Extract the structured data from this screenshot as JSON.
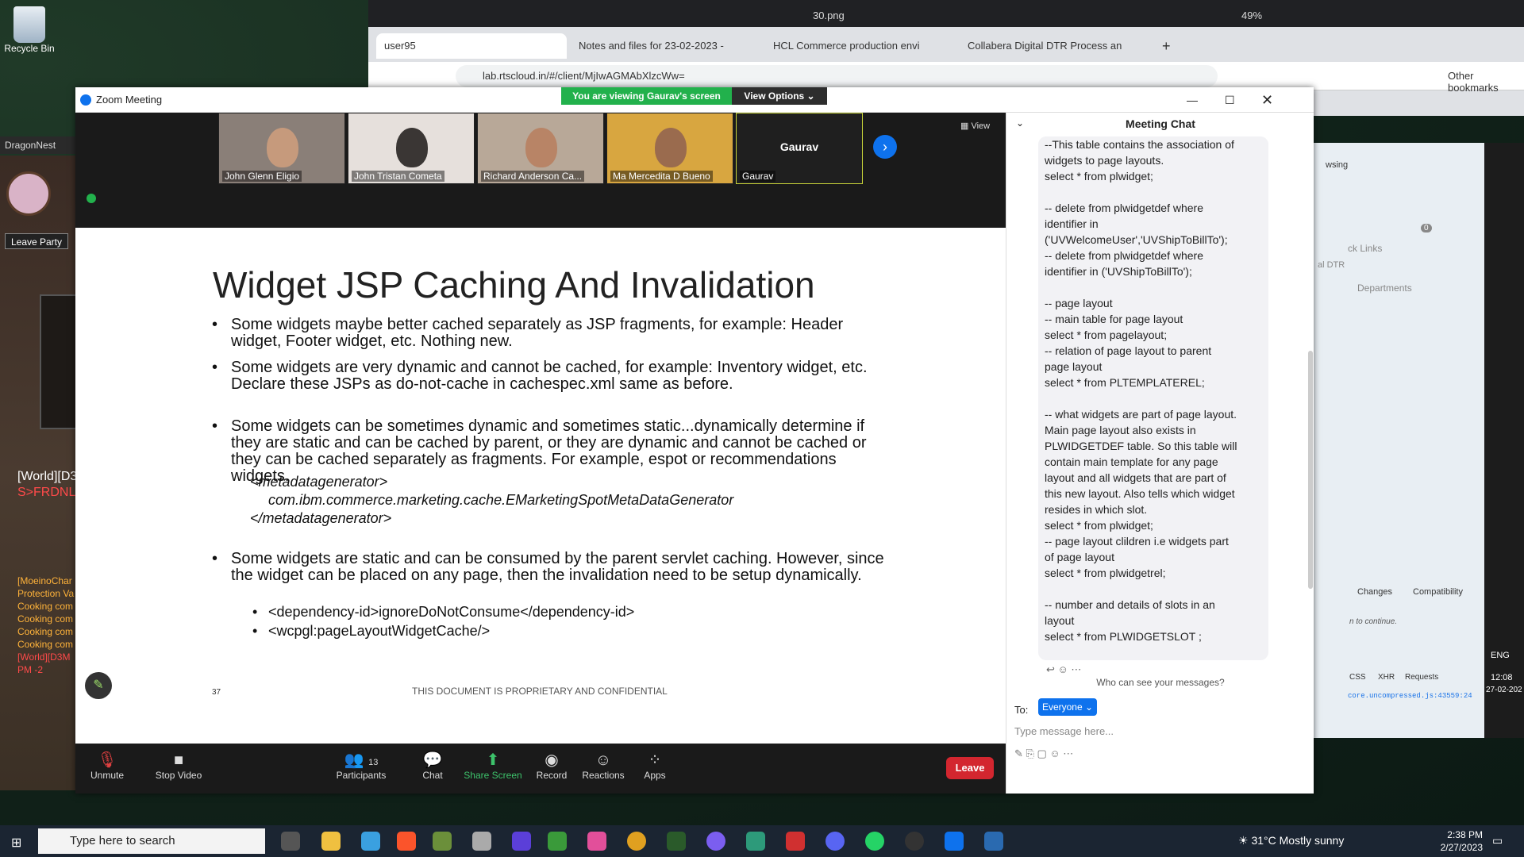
{
  "desktop": {
    "recycle_bin": "Recycle Bin",
    "dragonnest": "DragonNest"
  },
  "game": {
    "leave_party": "Leave Party",
    "world_line1": "[World][D3",
    "world_line2": "S>FRDNL",
    "chat_lines": [
      "[MoeinoChar",
      "Protection Va",
      "Cooking com",
      "Cooking com",
      "Cooking com",
      "Cooking com",
      "[World][D3M",
      "PM -2"
    ]
  },
  "browser": {
    "tabs": [
      {
        "label": "user95"
      },
      {
        "label": "Notes and files for 23-02-2023 -"
      },
      {
        "label": "HCL Commerce production envi"
      },
      {
        "label": "Collabera Digital DTR Process an"
      }
    ],
    "url": "lab.rtscloud.in/#/client/MjIwAGMAbXlzcWw=",
    "other_bookmarks": "Other bookmarks",
    "top_file": "30.png",
    "zoom_pct": "49%"
  },
  "zoom": {
    "title": "Zoom Meeting",
    "viewing_banner": "You are viewing Gaurav's screen",
    "view_options": "View Options",
    "view_label": "View",
    "participants": [
      {
        "name": "John Glenn Eligio"
      },
      {
        "name": "John Tristan Cometa"
      },
      {
        "name": "Richard Anderson Ca..."
      },
      {
        "name": "Ma Mercedita D Bueno"
      },
      {
        "name": "Gaurav",
        "display": "Gaurav"
      }
    ],
    "toolbar": {
      "unmute": "Unmute",
      "stop_video": "Stop Video",
      "participants": "Participants",
      "participants_count": "13",
      "chat": "Chat",
      "share_screen": "Share Screen",
      "record": "Record",
      "reactions": "Reactions",
      "apps": "Apps",
      "leave": "Leave"
    }
  },
  "slide": {
    "title": "Widget JSP Caching And Invalidation",
    "bullets": [
      "Some widgets maybe better cached separately as JSP fragments, for example: Header widget, Footer widget, etc. Nothing new.",
      "Some widgets are very dynamic and cannot be cached, for example: Inventory widget, etc. Declare these JSPs as do-not-cache in cachespec.xml same as before.",
      "Some widgets can be sometimes dynamic and sometimes static...dynamically determine if they are static and can be cached by parent, or they are dynamic and cannot be cached or they can be cached separately as fragments. For example, espot or recommendations widgets.",
      "Some widgets are static and can be consumed by the parent servlet caching. However, since the widget can be placed on any page, then the invalidation need to be setup dynamically."
    ],
    "code1": "<metadatagenerator>",
    "code2": "com.ibm.commerce.marketing.cache.EMarketingSpotMetaDataGenerator",
    "code3": "</metadatagenerator>",
    "sub1": "<dependency-id>ignoreDoNotConsume</dependency-id>",
    "sub2": "<wcpgl:pageLayoutWidgetCache/>",
    "footer": "THIS DOCUMENT IS PROPRIETARY AND CONFIDENTIAL",
    "page_number": "37"
  },
  "chat": {
    "header": "Meeting Chat",
    "message": "--This table contains the association of\nwidgets to page layouts.\nselect * from plwidget;\n\n-- delete from plwidgetdef where\nidentifier in\n('UVWelcomeUser','UVShipToBillTo');\n-- delete from plwidgetdef where\nidentifier in ('UVShipToBillTo');\n\n-- page layout\n-- main table for page layout\nselect * from pagelayout;\n-- relation of page layout to parent\npage layout\nselect * from PLTEMPLATEREL;\n\n-- what widgets are part of page layout.\nMain page layout also exists in\nPLWIDGETDEF table. So this table will\ncontain main template for any page\nlayout and all widgets that are part of\nthis new layout. Also tells which widget\nresides in which slot.\nselect * from plwidget;\n-- page layout clildren i.e widgets part\nof page layout\nselect * from plwidgetrel;\n\n-- number and details of slots in an\nlayout\nselect * from PLWIDGETSLOT ;",
    "who_can_see": "Who can see your messages?",
    "to_label": "To:",
    "everyone": "Everyone",
    "placeholder": "Type message here..."
  },
  "bg_right": {
    "links": "ck Links",
    "departments": "Departments",
    "dtr": "al DTR",
    "sing": "wsing",
    "changes": "Changes",
    "compat": "Compatibility",
    "to_continue": "n to continue.",
    "css": "CSS",
    "xhr": "XHR",
    "requests": "Requests",
    "js_file": "core.uncompressed.js:43559:24",
    "cart_count": "0"
  },
  "taskbar": {
    "search_placeholder": "Type here to search",
    "weather": "31°C  Mostly sunny",
    "lang": "ENG",
    "time": "2:38 PM",
    "date": "2/27/2023",
    "side_time": "12:08",
    "side_date": "27-02-202"
  }
}
